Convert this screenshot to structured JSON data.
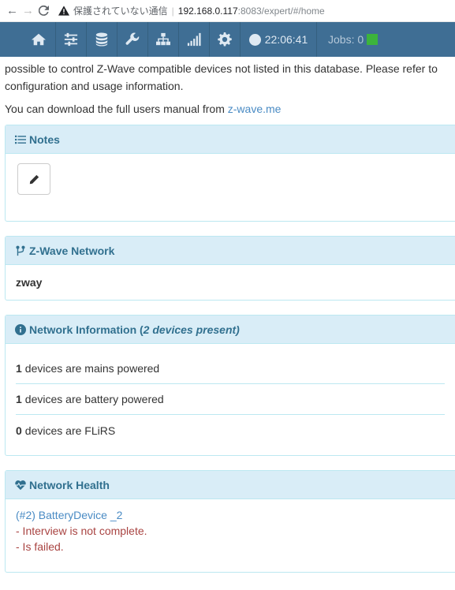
{
  "browser": {
    "security_text": "保護されていない通信",
    "separator": "|",
    "host": "192.168.0.117",
    "path": ":8083/expert/#/home"
  },
  "navbar": {
    "items": [
      {
        "icon": "home-icon"
      },
      {
        "icon": "sliders-icon"
      },
      {
        "icon": "database-icon"
      },
      {
        "icon": "wrench-icon"
      },
      {
        "icon": "network-icon"
      },
      {
        "icon": "signal-icon"
      },
      {
        "icon": "gear-icon"
      }
    ],
    "clock": "22:06:41",
    "jobs_label": "Jobs: 0",
    "jobs_color": "#3cb43c",
    "bar_color": "#3f6e94"
  },
  "intro": {
    "line1": "possible to control Z-Wave compatible devices not listed in this database. Please refer to",
    "line2": "configuration and usage information.",
    "download_prefix": "You can download the full users manual from ",
    "download_link": "z-wave.me"
  },
  "notes": {
    "title": "Notes"
  },
  "zwave_network": {
    "title": "Z-Wave Network",
    "name": "zway"
  },
  "network_info": {
    "title_prefix": "Network Information (",
    "title_em": "2 devices present)",
    "rows": [
      {
        "count": "1",
        "text": "devices are mains powered"
      },
      {
        "count": "1",
        "text": "devices are battery powered"
      },
      {
        "count": "0",
        "text": "devices are FLiRS"
      }
    ]
  },
  "network_health": {
    "title": "Network Health",
    "device": "(#2) BatteryDevice _2",
    "errors": [
      "- Interview is not complete.",
      "- Is failed."
    ]
  }
}
